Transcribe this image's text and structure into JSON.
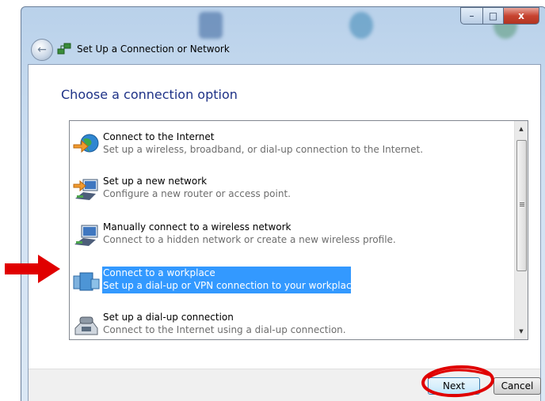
{
  "window": {
    "title": "Set Up a Connection or Network",
    "controls": {
      "minimize": "–",
      "maximize": "□",
      "close": "x"
    }
  },
  "heading": "Choose a connection option",
  "options": [
    {
      "title": "Connect to the Internet",
      "description": "Set up a wireless, broadband, or dial-up connection to the Internet.",
      "icon": "globe-network-icon"
    },
    {
      "title": "Set up a new network",
      "description": "Configure a new router or access point.",
      "icon": "router-network-icon"
    },
    {
      "title": "Manually connect to a wireless network",
      "description": "Connect to a hidden network or create a new wireless profile.",
      "icon": "wireless-network-icon"
    },
    {
      "title": "Connect to a workplace",
      "description": "Set up a dial-up or VPN connection to your workplace.",
      "icon": "workplace-building-icon",
      "selected": true
    },
    {
      "title": "Set up a dial-up connection",
      "description": "Connect to the Internet using a dial-up connection.",
      "icon": "telephone-modem-icon"
    }
  ],
  "buttons": {
    "next": "Next",
    "cancel": "Cancel"
  },
  "colors": {
    "selection": "#3399ff",
    "heading": "#1e3287",
    "annotation": "#e00000"
  }
}
